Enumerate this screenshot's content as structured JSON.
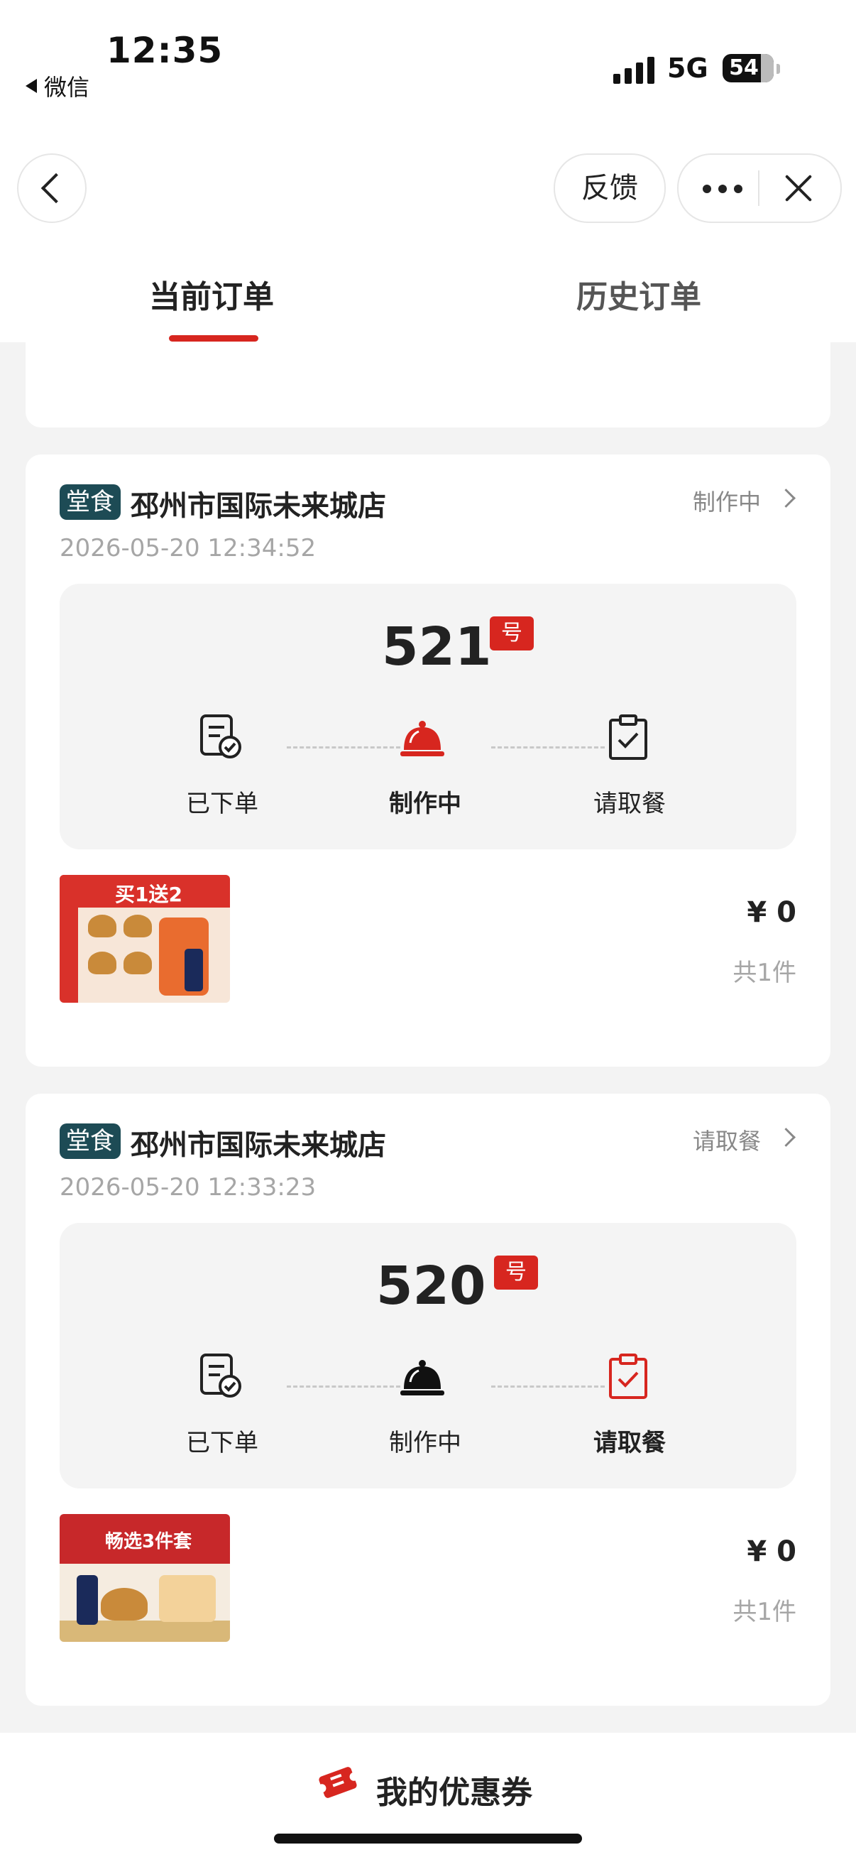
{
  "status_bar": {
    "time": "12:35",
    "back_app": "微信",
    "network": "5G",
    "battery": "54"
  },
  "header": {
    "feedback": "反馈"
  },
  "tabs": [
    {
      "label": "当前订单",
      "active": true
    },
    {
      "label": "历史订单",
      "active": false
    }
  ],
  "orders": [
    {
      "dine_type": "堂食",
      "store": "邳州市国际未来城店",
      "status": "制作中",
      "datetime": "2026-05-20 12:34:52",
      "number": "521",
      "number_suffix": "号",
      "steps": [
        "已下单",
        "制作中",
        "请取餐"
      ],
      "active_step": 1,
      "product_title": "买1送2",
      "price": "¥ 0",
      "count": "共1件"
    },
    {
      "dine_type": "堂食",
      "store": "邳州市国际未来城店",
      "status": "请取餐",
      "datetime": "2026-05-20 12:33:23",
      "number": "520",
      "number_suffix": "号",
      "steps": [
        "已下单",
        "制作中",
        "请取餐"
      ],
      "active_step": 2,
      "product_title": "畅选3件套",
      "price": "¥ 0",
      "count": "共1件"
    }
  ],
  "footer": {
    "coupon_label": "我的优惠券"
  },
  "colors": {
    "accent": "#d7261f",
    "badge": "#1d4b55"
  }
}
